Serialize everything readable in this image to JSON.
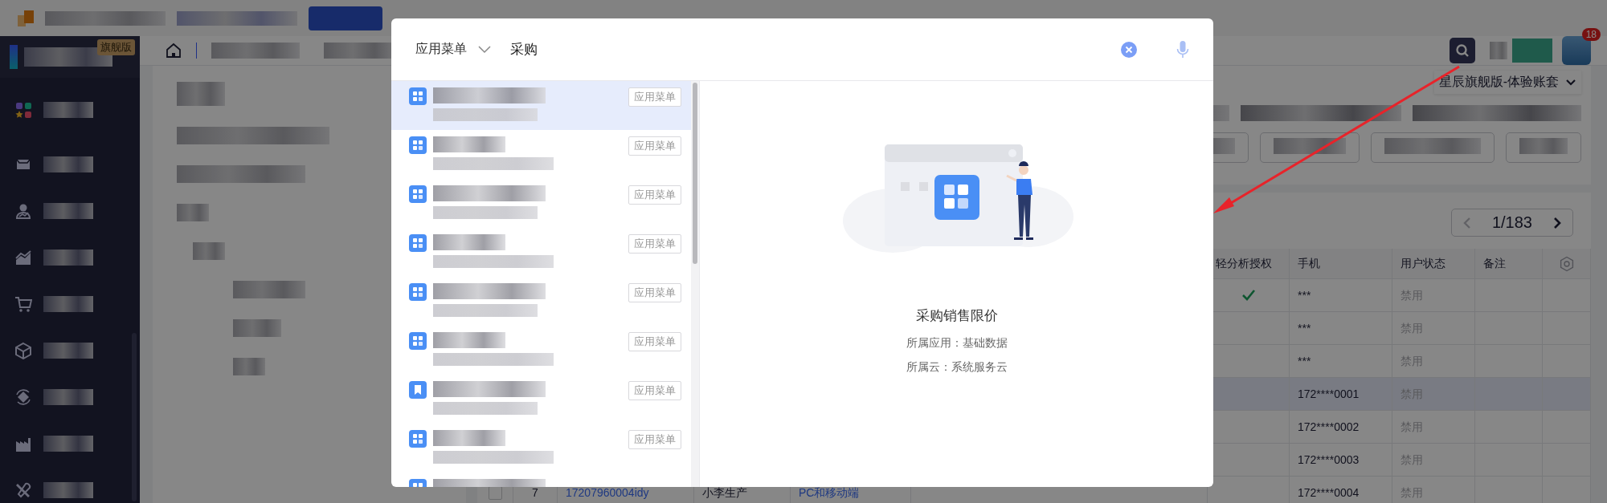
{
  "sidebar": {
    "edition_badge": "旗舰版"
  },
  "header": {
    "notification_count": "18"
  },
  "account_selector": {
    "label": "星辰旗舰版-体验账套"
  },
  "pagination": {
    "page": "1/183"
  },
  "table": {
    "columns": [
      "轻分析授权",
      "手机",
      "用户状态",
      "备注"
    ],
    "rows": [
      {
        "selected": false,
        "authorized": true,
        "phone": "***",
        "status": "禁用"
      },
      {
        "selected": false,
        "authorized": false,
        "phone": "***",
        "status": "禁用"
      },
      {
        "selected": false,
        "authorized": false,
        "phone": "***",
        "status": "禁用"
      },
      {
        "selected": true,
        "authorized": false,
        "phone": "172****0001",
        "status": "禁用"
      },
      {
        "selected": false,
        "authorized": false,
        "phone": "172****0002",
        "status": "禁用"
      },
      {
        "selected": false,
        "authorized": false,
        "phone": "172****0003",
        "status": "禁用"
      },
      {
        "selected": false,
        "authorized": false,
        "index": "7",
        "account": "17207960004idy",
        "name": "小李生产",
        "client": "PC和移动端",
        "phone": "172****0004",
        "status": "禁用"
      }
    ]
  },
  "search_modal": {
    "scope": "应用菜单",
    "query": "采购",
    "results": [
      {
        "kind": "grid",
        "tag": "应用菜单",
        "selected": true
      },
      {
        "kind": "grid",
        "tag": "应用菜单",
        "selected": false
      },
      {
        "kind": "grid",
        "tag": "应用菜单",
        "selected": false
      },
      {
        "kind": "grid",
        "tag": "应用菜单",
        "selected": false
      },
      {
        "kind": "grid",
        "tag": "应用菜单",
        "selected": false
      },
      {
        "kind": "grid",
        "tag": "应用菜单",
        "selected": false
      },
      {
        "kind": "bookmark",
        "tag": "应用菜单",
        "selected": false
      },
      {
        "kind": "grid",
        "tag": "应用菜单",
        "selected": false
      },
      {
        "kind": "grid",
        "selected": false
      }
    ],
    "detail": {
      "title": "采购销售限价",
      "app_line": "所属应用：基础数据",
      "cloud_line": "所属云：系统服务云"
    }
  }
}
